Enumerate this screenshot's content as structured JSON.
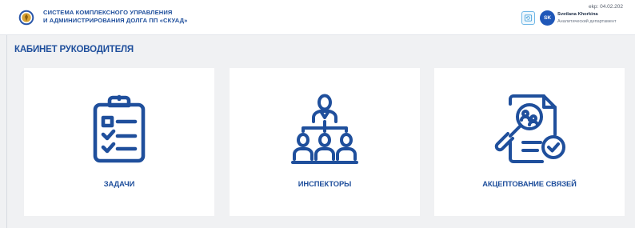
{
  "header": {
    "title_line1": "СИСТЕМА КОМПЛЕКСНОГО УПРАВЛЕНИЯ",
    "title_line2": "И АДМИНИСТРИРОВАНИЯ ДОЛГА ПП «СКУАД»",
    "version": "ekp: 04.02.202",
    "user": {
      "initials": "SK",
      "name": "Svetlana Khorkina",
      "department": "Аналитический департамент"
    }
  },
  "page": {
    "title": "КАБИНЕТ РУКОВОДИТЕЛЯ"
  },
  "cards": [
    {
      "label": "ЗАДАЧИ",
      "icon": "clipboard-checklist-icon"
    },
    {
      "label": "ИНСПЕКТОРЫ",
      "icon": "org-hierarchy-icon"
    },
    {
      "label": "АКЦЕПТОВАНИЕ СВЯЗЕЙ",
      "icon": "document-search-check-icon"
    }
  ],
  "colors": {
    "accent": "#1f4f9c",
    "avatar": "#1f57b8",
    "background": "#f0f1f3"
  }
}
